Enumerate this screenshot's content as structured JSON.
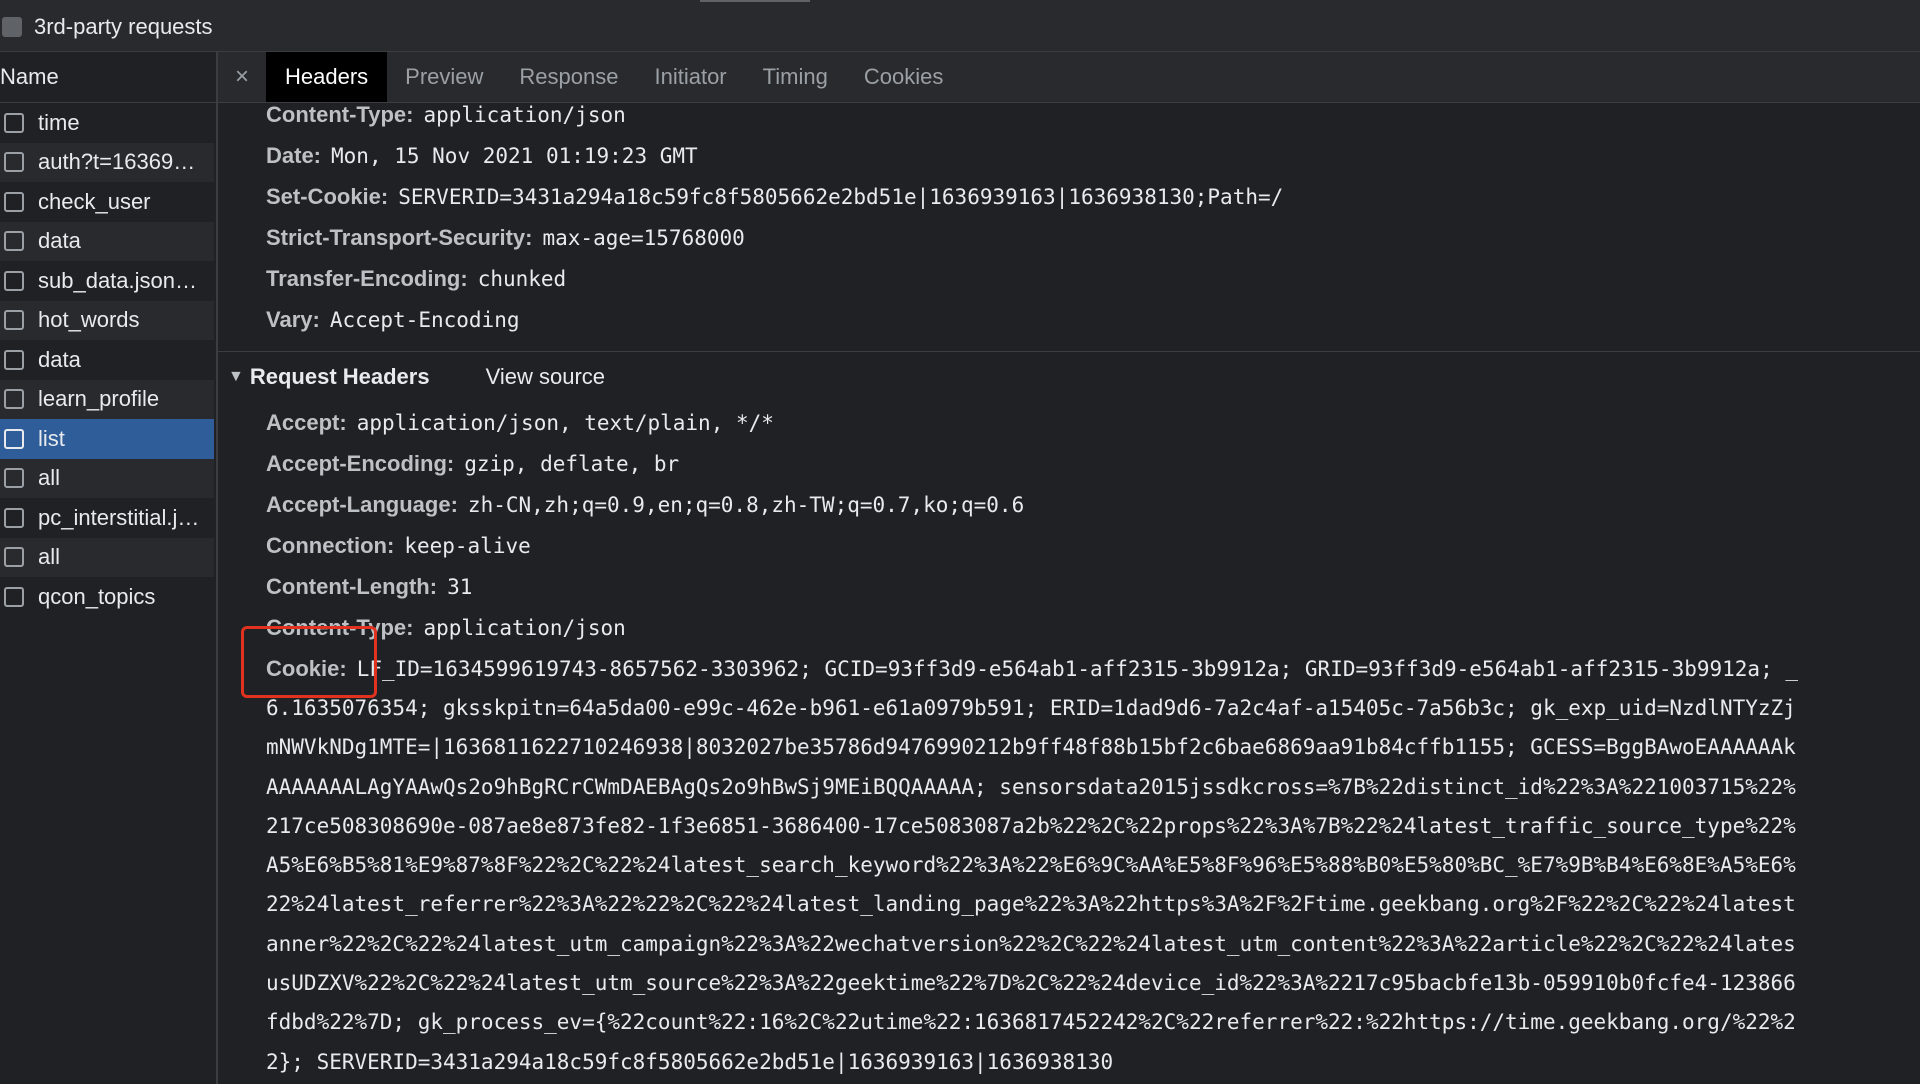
{
  "filter": {
    "third_party_label": "3rd-party requests"
  },
  "sidebar": {
    "name_header": "Name",
    "items": [
      {
        "label": "time"
      },
      {
        "label": "auth?t=16369…"
      },
      {
        "label": "check_user"
      },
      {
        "label": "data"
      },
      {
        "label": "sub_data.json…"
      },
      {
        "label": "hot_words"
      },
      {
        "label": "data"
      },
      {
        "label": "learn_profile"
      },
      {
        "label": "list",
        "selected": true
      },
      {
        "label": "all"
      },
      {
        "label": "pc_interstitial.j…"
      },
      {
        "label": "all"
      },
      {
        "label": "qcon_topics"
      }
    ]
  },
  "tabs": {
    "close_glyph": "×",
    "items": [
      {
        "label": "Headers",
        "active": true
      },
      {
        "label": "Preview"
      },
      {
        "label": "Response"
      },
      {
        "label": "Initiator"
      },
      {
        "label": "Timing"
      },
      {
        "label": "Cookies"
      }
    ]
  },
  "response_headers": [
    {
      "key": "Content-Type:",
      "value": "application/json"
    },
    {
      "key": "Date:",
      "value": "Mon, 15 Nov 2021 01:19:23 GMT"
    },
    {
      "key": "Set-Cookie:",
      "value": "SERVERID=3431a294a18c59fc8f5805662e2bd51e|1636939163|1636938130;Path=/"
    },
    {
      "key": "Strict-Transport-Security:",
      "value": "max-age=15768000"
    },
    {
      "key": "Transfer-Encoding:",
      "value": "chunked"
    },
    {
      "key": "Vary:",
      "value": "Accept-Encoding"
    }
  ],
  "request_section": {
    "title": "Request Headers",
    "view_source": "View source"
  },
  "request_headers": [
    {
      "key": "Accept:",
      "value": "application/json, text/plain, */*"
    },
    {
      "key": "Accept-Encoding:",
      "value": "gzip, deflate, br"
    },
    {
      "key": "Accept-Language:",
      "value": "zh-CN,zh;q=0.9,en;q=0.8,zh-TW;q=0.7,ko;q=0.6"
    },
    {
      "key": "Connection:",
      "value": "keep-alive"
    },
    {
      "key": "Content-Length:",
      "value": "31"
    },
    {
      "key": "Content-Type:",
      "value": "application/json"
    },
    {
      "key": "Cookie:",
      "value": "LF_ID=1634599619743-8657562-3303962; GCID=93ff3d9-e564ab1-aff2315-3b9912a; GRID=93ff3d9-e564ab1-aff2315-3b9912a; _"
    }
  ],
  "cookie_continuation": [
    "6.1635076354; gksskpitn=64a5da00-e99c-462e-b961-e61a0979b591; ERID=1dad9d6-7a2c4af-a15405c-7a56b3c; gk_exp_uid=NzdlNTYzZj",
    "mNWVkNDg1MTE=|1636811622710246938|8032027be35786d9476990212b9ff48f88b15bf2c6bae6869aa91b84cffb1155; GCESS=BggBAwoEAAAAAAk",
    "AAAAAAALAgYAAwQs2o9hBgRCrCWmDAEBAgQs2o9hBwSj9MEiBQQAAAAA; sensorsdata2015jssdkcross=%7B%22distinct_id%22%3A%221003715%22%",
    "217ce508308690e-087ae8e873fe82-1f3e6851-3686400-17ce5083087a2b%22%2C%22props%22%3A%7B%22%24latest_traffic_source_type%22%",
    "A5%E6%B5%81%E9%87%8F%22%2C%22%24latest_search_keyword%22%3A%22%E6%9C%AA%E5%8F%96%E5%88%B0%E5%80%BC_%E7%9B%B4%E6%8E%A5%E6%",
    "22%24latest_referrer%22%3A%22%22%2C%22%24latest_landing_page%22%3A%22https%3A%2F%2Ftime.geekbang.org%2F%22%2C%22%24latest",
    "anner%22%2C%22%24latest_utm_campaign%22%3A%22wechatversion%22%2C%22%24latest_utm_content%22%3A%22article%22%2C%22%24lates",
    "usUDZXV%22%2C%22%24latest_utm_source%22%3A%22geektime%22%7D%2C%22%24device_id%22%3A%2217c95bacbfe13b-059910b0fcfe4-123866",
    "fdbd%22%7D; gk_process_ev={%22count%22:16%2C%22utime%22:1636817452242%2C%22referrer%22:%22https://time.geekbang.org/%22%2",
    "2}; SERVERID=3431a294a18c59fc8f5805662e2bd51e|1636939163|1636938130"
  ]
}
